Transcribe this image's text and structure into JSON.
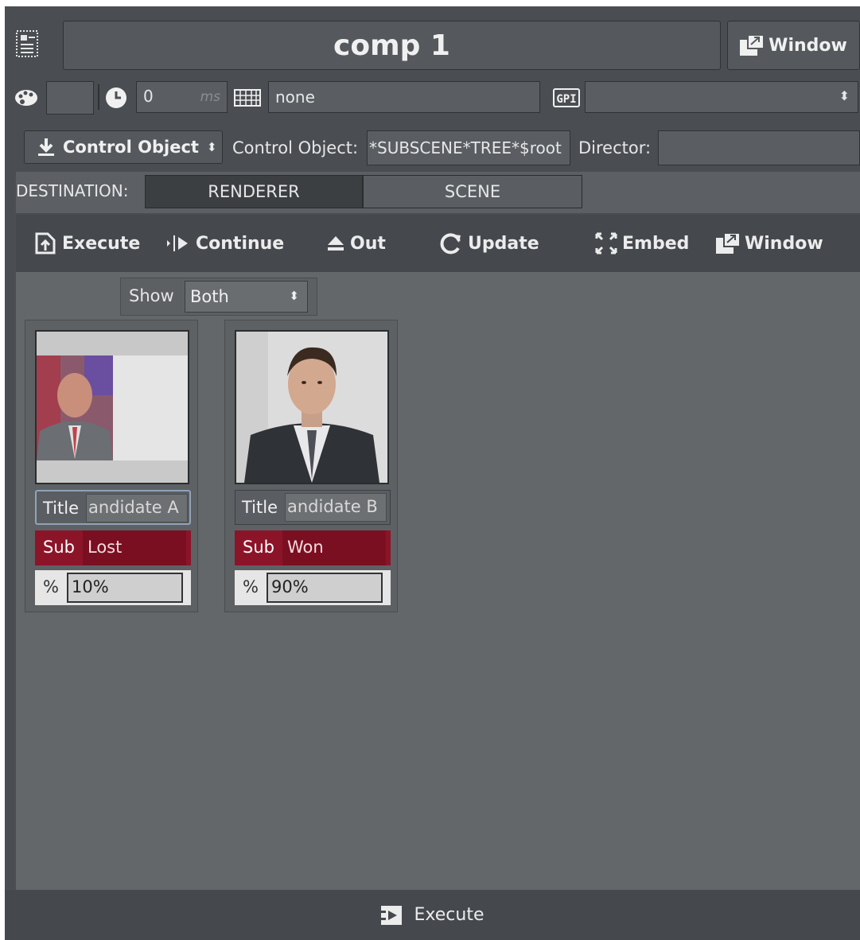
{
  "header": {
    "title": "comp 1",
    "window_label": "Window"
  },
  "settings": {
    "delay_value": "0",
    "delay_unit": "ms",
    "keyboard_value": "none",
    "gpi_value": ""
  },
  "control": {
    "mode_label": "Control Object",
    "object_label": "Control Object:",
    "object_path": "*SUBSCENE*TREE*$root",
    "director_label": "Director:",
    "director_value": ""
  },
  "destination": {
    "label": "DESTINATION:",
    "options": [
      "RENDERER",
      "SCENE"
    ],
    "selected": "RENDERER"
  },
  "toolbar": {
    "execute": "Execute",
    "continue": "Continue",
    "out": "Out",
    "update": "Update",
    "embed": "Embed",
    "window": "Window"
  },
  "filter": {
    "show_label": "Show",
    "show_value": "Both"
  },
  "cards": [
    {
      "title_key": "Title",
      "title_value": "andidate A",
      "sub_key": "Sub",
      "sub_value": "Lost",
      "pct_key": "%",
      "pct_value": "10%"
    },
    {
      "title_key": "Title",
      "title_value": "andidate B",
      "sub_key": "Sub",
      "sub_value": "Won",
      "pct_key": "%",
      "pct_value": "90%"
    }
  ],
  "footer": {
    "execute_label": "Execute"
  },
  "colors": {
    "background": "#4a4e52",
    "content": "#646769",
    "sub_red": "#8c1429",
    "selected_segment": "#3c3f42"
  }
}
